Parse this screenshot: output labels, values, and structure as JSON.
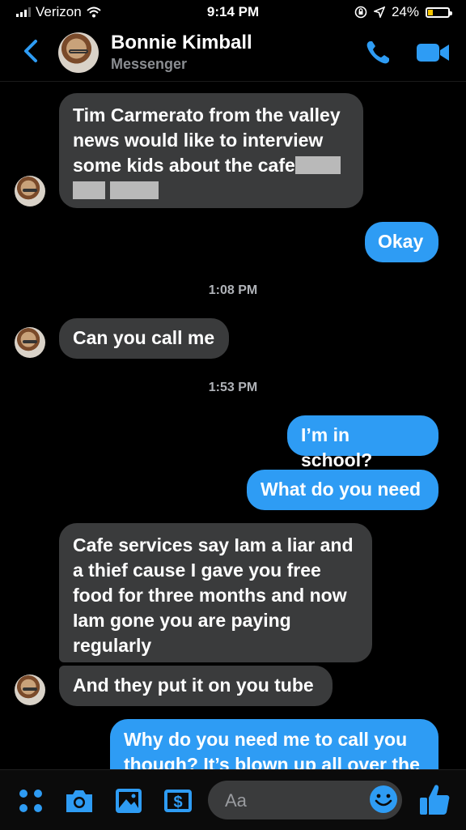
{
  "status": {
    "carrier": "Verizon",
    "time": "9:14 PM",
    "battery": "24%",
    "battery_level": 0.24
  },
  "header": {
    "name": "Bonnie Kimball",
    "subtitle": "Messenger"
  },
  "messages": {
    "m1_line1": "Tim Carmerato from the valley",
    "m1_line2": "news would like to interview",
    "m1_line3": "some kids about the cafe",
    "m2": "Okay",
    "t1": "1:08 PM",
    "m3": "Can you call me",
    "t2": "1:53 PM",
    "m4": "I’m in school?",
    "m5": "What do you need",
    "m6_line1": "Cafe services say Iam a liar and",
    "m6_line2": "a thief cause I gave you free",
    "m6_line3": "food for three months and now",
    "m6_line4": "Iam gone you are paying",
    "m6_line5": "regularly",
    "m7": "And they put it on you tube",
    "m8_line1": "Why do you need me to call you",
    "m8_line2": "though? It’s blown up all over the"
  },
  "composer": {
    "placeholder": "Aa"
  },
  "colors": {
    "accent": "#2e9cf4",
    "incoming": "#3a3b3c",
    "battery": "#f5c400"
  }
}
